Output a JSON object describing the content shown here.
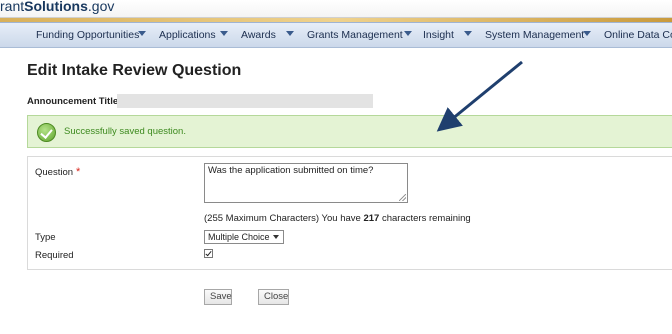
{
  "header": {
    "logo_prefix": "rant",
    "logo_bold": "Solutions",
    "logo_suffix": ".gov"
  },
  "nav": {
    "items": [
      {
        "label": "Funding Opportunities"
      },
      {
        "label": "Applications"
      },
      {
        "label": "Awards"
      },
      {
        "label": "Grants Management"
      },
      {
        "label": "Insight"
      },
      {
        "label": "System Management"
      },
      {
        "label": "Online Data Colle"
      }
    ]
  },
  "page": {
    "title": "Edit Intake Review Question",
    "announcement_label": "Announcement Title:",
    "success_message": "Successfully saved question."
  },
  "form": {
    "question_label": "Question",
    "required_star": "*",
    "question_value": "Was the application submitted on time?",
    "char_prefix": "(255 Maximum Characters) You have ",
    "char_remaining": "217",
    "char_suffix": " characters remaining",
    "type_label": "Type",
    "type_value": "Multiple Choice",
    "required_label": "Required",
    "required_checked": true
  },
  "buttons": {
    "save": "Save",
    "close": "Close"
  },
  "colors": {
    "success_bg": "#e4f3d4",
    "success_text": "#3d8a1f",
    "annotation_arrow": "#1f3f6e"
  }
}
